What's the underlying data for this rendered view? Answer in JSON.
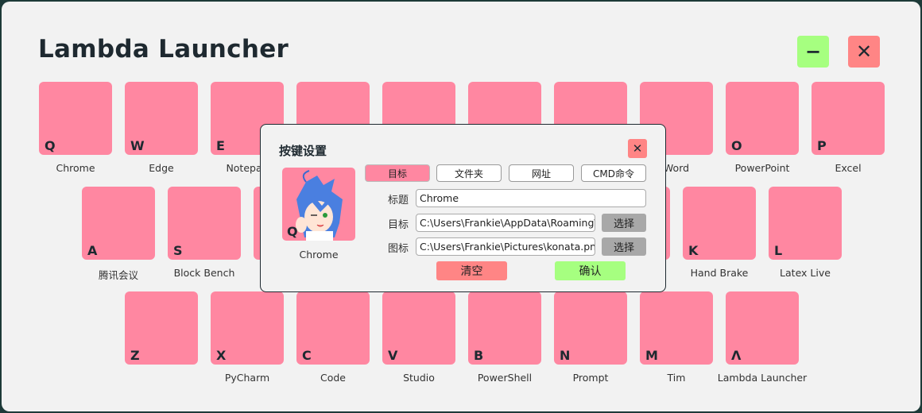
{
  "app": {
    "title": "Lambda Launcher",
    "minimize_icon": "minus-icon",
    "close_icon": "close-icon",
    "colors": {
      "key": "#ff87a1",
      "minimize": "#a6ff80",
      "close": "#ff8585",
      "background": "#f2f2f2"
    }
  },
  "rows": [
    [
      {
        "letter": "Q",
        "label": "Chrome"
      },
      {
        "letter": "W",
        "label": "Edge"
      },
      {
        "letter": "E",
        "label": "Notepad"
      },
      {
        "letter": "",
        "label": ""
      },
      {
        "letter": "",
        "label": ""
      },
      {
        "letter": "",
        "label": ""
      },
      {
        "letter": "",
        "label": ""
      },
      {
        "letter": "",
        "label": "Word"
      },
      {
        "letter": "O",
        "label": "PowerPoint"
      },
      {
        "letter": "P",
        "label": "Excel"
      }
    ],
    [
      {
        "letter": "A",
        "label": "腾讯会议"
      },
      {
        "letter": "S",
        "label": "Block Bench"
      },
      {
        "letter": "",
        "label": ""
      },
      {
        "letter": "",
        "label": ""
      },
      {
        "letter": "",
        "label": ""
      },
      {
        "letter": "",
        "label": ""
      },
      {
        "letter": "",
        "label": ""
      },
      {
        "letter": "K",
        "label": "Hand Brake"
      },
      {
        "letter": "L",
        "label": "Latex Live"
      }
    ],
    [
      {
        "letter": "Z",
        "label": ""
      },
      {
        "letter": "X",
        "label": "PyCharm"
      },
      {
        "letter": "C",
        "label": "Code"
      },
      {
        "letter": "V",
        "label": "Studio"
      },
      {
        "letter": "B",
        "label": "PowerShell"
      },
      {
        "letter": "N",
        "label": "Prompt"
      },
      {
        "letter": "M",
        "label": "Tim"
      },
      {
        "letter": "Λ",
        "label": "Lambda Launcher"
      }
    ]
  ],
  "dialog": {
    "title": "按键设置",
    "key_letter": "Q",
    "key_name": "Chrome",
    "tabs": [
      {
        "label": "目标",
        "active": true
      },
      {
        "label": "文件夹"
      },
      {
        "label": "网址"
      },
      {
        "label": "CMD命令"
      }
    ],
    "fields": {
      "title_label": "标题",
      "title_value": "Chrome",
      "target_label": "目标",
      "target_value": "C:\\Users\\Frankie\\AppData\\Roaming\\Microsoft",
      "icon_label": "图标",
      "icon_value": "C:\\Users\\Frankie\\Pictures\\konata.png",
      "choose": "选择"
    },
    "clear": "清空",
    "confirm": "确认"
  }
}
